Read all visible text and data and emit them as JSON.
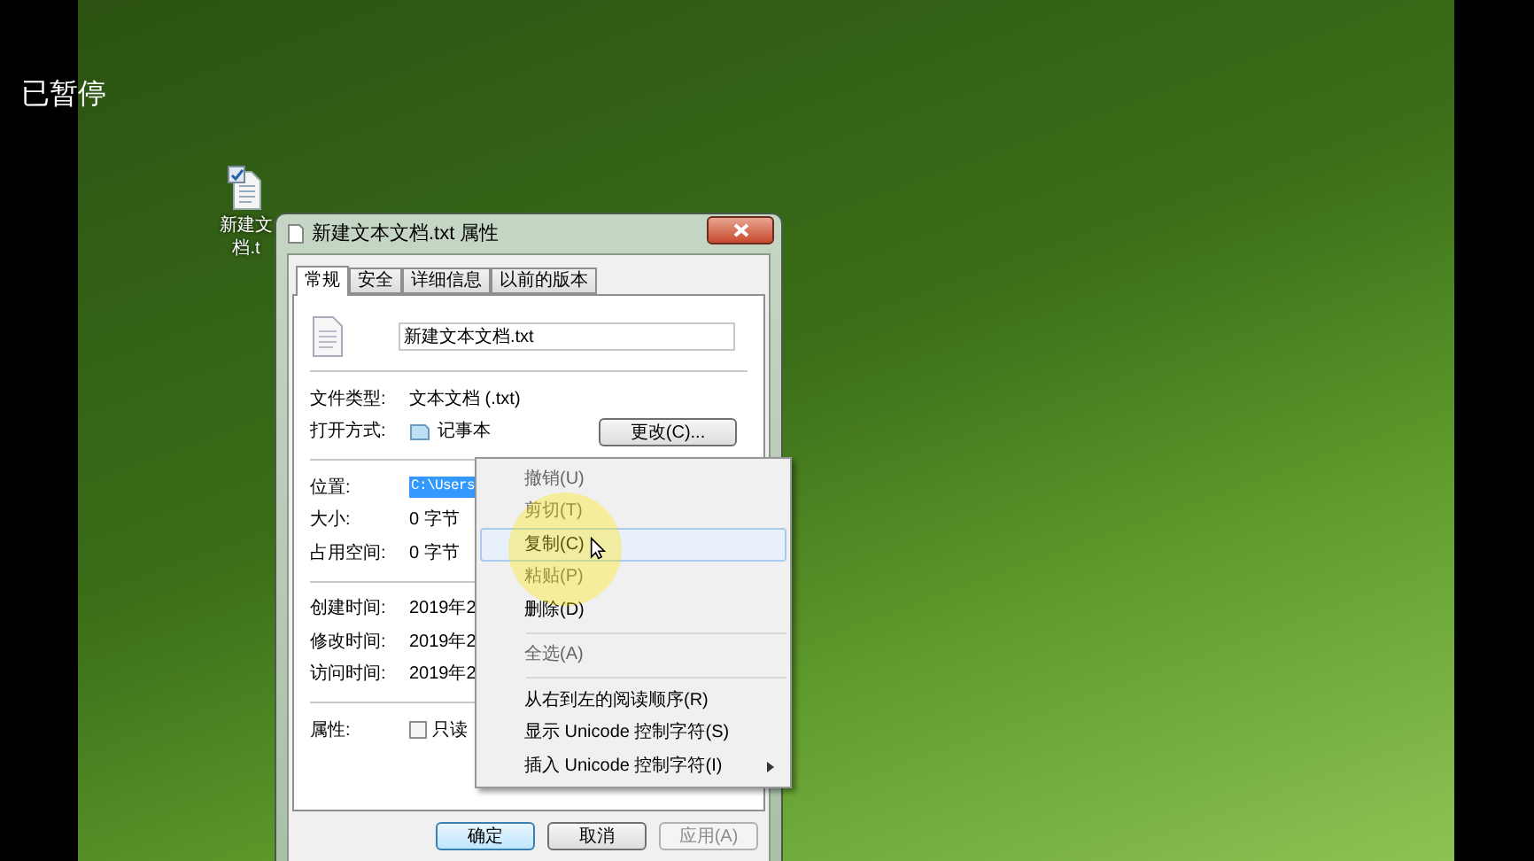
{
  "player": {
    "status": "已暂停"
  },
  "desktop_icons": [
    {
      "label_lines": [
        "新建文",
        "档.t"
      ]
    }
  ],
  "dialog": {
    "title": "新建文本文档.txt 属性",
    "tabs": [
      {
        "label": "常规",
        "selected": true
      },
      {
        "label": "安全",
        "selected": false
      },
      {
        "label": "详细信息",
        "selected": false
      },
      {
        "label": "以前的版本",
        "selected": false
      }
    ],
    "file_name": "新建文本文档.txt",
    "groups": [
      [
        {
          "label": "文件类型:",
          "value": "文本文档 (.txt)",
          "kind": "text"
        },
        {
          "label": "打开方式:",
          "value": "记事本",
          "kind": "app",
          "button": "更改(C)..."
        }
      ],
      [
        {
          "label": "位置:",
          "value": "C:\\Users",
          "kind": "selected_text"
        },
        {
          "label": "大小:",
          "value": "0 字节",
          "kind": "text"
        },
        {
          "label": "占用空间:",
          "value": "0 字节",
          "kind": "text"
        }
      ],
      [
        {
          "label": "创建时间:",
          "value": "2019年2",
          "kind": "text"
        },
        {
          "label": "修改时间:",
          "value": "2019年2",
          "kind": "text"
        },
        {
          "label": "访问时间:",
          "value": "2019年2",
          "kind": "text"
        }
      ],
      [
        {
          "label": "属性:",
          "value": "只读",
          "kind": "checkbox",
          "checked": false
        }
      ]
    ],
    "buttons": [
      {
        "label": "确定",
        "default": true,
        "disabled": false
      },
      {
        "label": "取消",
        "default": false,
        "disabled": false
      },
      {
        "label": "应用(A)",
        "default": false,
        "disabled": true
      }
    ]
  },
  "context_menu": [
    {
      "kind": "item",
      "label": "撤销(U)",
      "disabled": true,
      "selected": false,
      "submenu": false
    },
    {
      "kind": "item",
      "label": "剪切(T)",
      "disabled": true,
      "selected": false,
      "submenu": false
    },
    {
      "kind": "item",
      "label": "复制(C)",
      "disabled": false,
      "selected": true,
      "submenu": false
    },
    {
      "kind": "item",
      "label": "粘贴(P)",
      "disabled": true,
      "selected": false,
      "submenu": false
    },
    {
      "kind": "item",
      "label": "删除(D)",
      "disabled": false,
      "selected": false,
      "submenu": false
    },
    {
      "kind": "separator"
    },
    {
      "kind": "item",
      "label": "全选(A)",
      "disabled": true,
      "selected": false,
      "submenu": false
    },
    {
      "kind": "separator"
    },
    {
      "kind": "item",
      "label": "从右到左的阅读顺序(R)",
      "disabled": false,
      "selected": false,
      "submenu": false
    },
    {
      "kind": "item",
      "label": "显示 Unicode 控制字符(S)",
      "disabled": false,
      "selected": false,
      "submenu": false
    },
    {
      "kind": "item",
      "label": "插入 Unicode 控制字符(I)",
      "disabled": false,
      "selected": false,
      "submenu": true
    }
  ]
}
